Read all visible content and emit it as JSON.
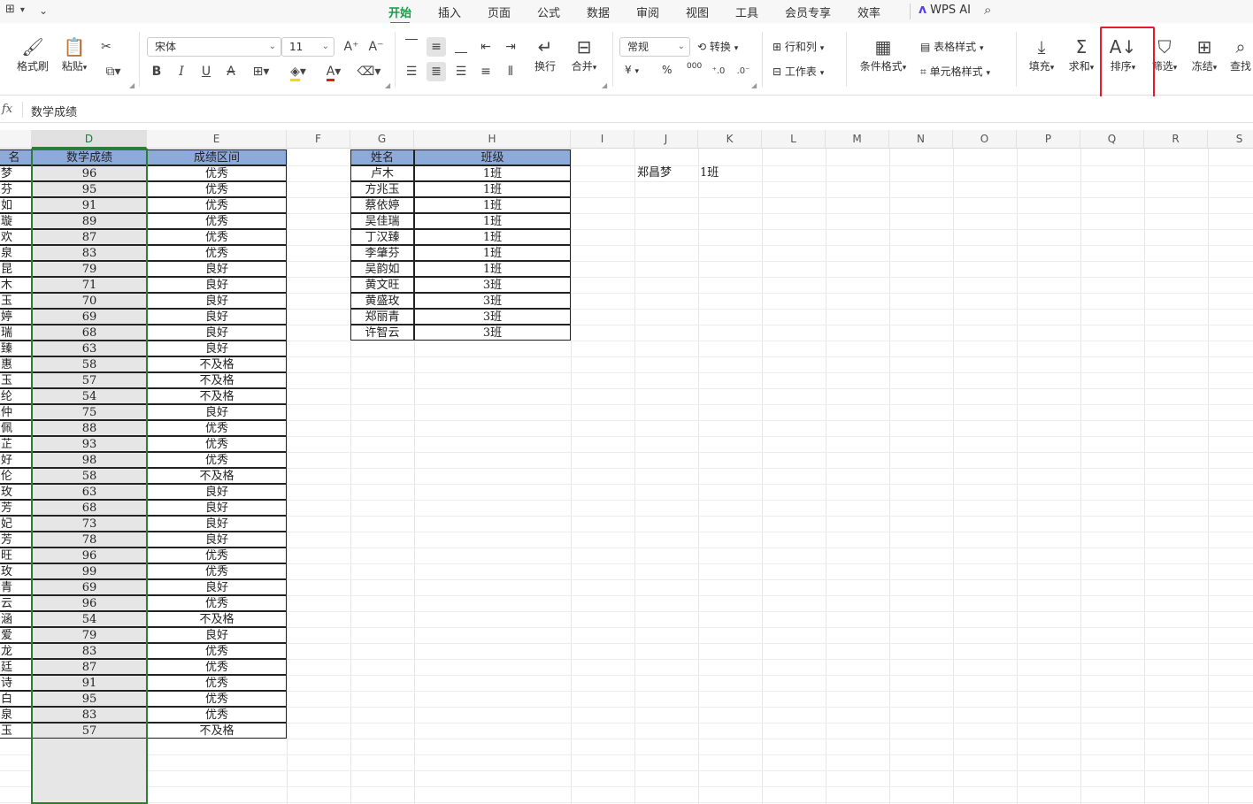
{
  "menubar": {
    "tabs": [
      "开始",
      "插入",
      "页面",
      "公式",
      "数据",
      "审阅",
      "视图",
      "工具",
      "会员专享",
      "效率"
    ],
    "active_tab": "开始",
    "wps_ai": "WPS AI"
  },
  "ribbon": {
    "format_painter": "格式刷",
    "paste": "粘贴",
    "font_name": "宋体",
    "font_size": "11",
    "wrap": "换行",
    "merge": "合并",
    "number_format": "常规",
    "convert": "转换",
    "rows_cols": "行和列",
    "worksheet": "工作表",
    "conditional_format": "条件格式",
    "table_style": "表格样式",
    "cell_style": "单元格样式",
    "fill": "填充",
    "sum": "求和",
    "sort": "排序",
    "filter": "筛选",
    "freeze": "冻结",
    "find": "查找",
    "currency_symbol": "¥",
    "percent_symbol": "%",
    "thousands_symbol": "000"
  },
  "formula_bar": {
    "fx": "fx",
    "content": "数学成绩"
  },
  "columns": [
    "D",
    "E",
    "F",
    "G",
    "H",
    "I",
    "J",
    "K",
    "L",
    "M",
    "N",
    "O",
    "P",
    "Q",
    "R",
    "S"
  ],
  "left_table": {
    "c_header": "名",
    "d_header": "数学成绩",
    "e_header": "成绩区间",
    "name_tails": [
      "梦",
      "芬",
      "如",
      "璇",
      "欢",
      "泉",
      "昆",
      "木",
      "玉",
      "婷",
      "瑞",
      "臻",
      "惠",
      "玉",
      "纶",
      "仲",
      "佩",
      "芷",
      "好",
      "伦",
      "玫",
      "芳",
      "妃",
      "芳",
      "旺",
      "玫",
      "青",
      "云",
      "涵",
      "爱",
      "龙",
      "廷",
      "诗",
      "白",
      "泉",
      "玉"
    ],
    "scores": [
      "96",
      "95",
      "91",
      "89",
      "87",
      "83",
      "79",
      "71",
      "70",
      "69",
      "68",
      "63",
      "58",
      "57",
      "54",
      "75",
      "88",
      "93",
      "98",
      "58",
      "63",
      "68",
      "73",
      "78",
      "96",
      "99",
      "69",
      "96",
      "54",
      "79",
      "83",
      "87",
      "91",
      "95",
      "83",
      "57"
    ],
    "levels": [
      "优秀",
      "优秀",
      "优秀",
      "优秀",
      "优秀",
      "优秀",
      "良好",
      "良好",
      "良好",
      "良好",
      "良好",
      "良好",
      "不及格",
      "不及格",
      "不及格",
      "良好",
      "优秀",
      "优秀",
      "优秀",
      "不及格",
      "良好",
      "良好",
      "良好",
      "良好",
      "优秀",
      "优秀",
      "良好",
      "优秀",
      "不及格",
      "良好",
      "优秀",
      "优秀",
      "优秀",
      "优秀",
      "优秀",
      "不及格"
    ]
  },
  "right_table": {
    "g_header": "姓名",
    "h_header": "班级",
    "names": [
      "卢木",
      "方兆玉",
      "蔡依婷",
      "吴佳瑞",
      "丁汉臻",
      "李肇芬",
      "吴韵如",
      "黄文旺",
      "黄盛玫",
      "郑丽青",
      "许智云"
    ],
    "classes": [
      "1班",
      "1班",
      "1班",
      "1班",
      "1班",
      "1班",
      "1班",
      "3班",
      "3班",
      "3班",
      "3班"
    ]
  },
  "lookup": {
    "j2": "郑昌梦",
    "k2": "1班"
  }
}
